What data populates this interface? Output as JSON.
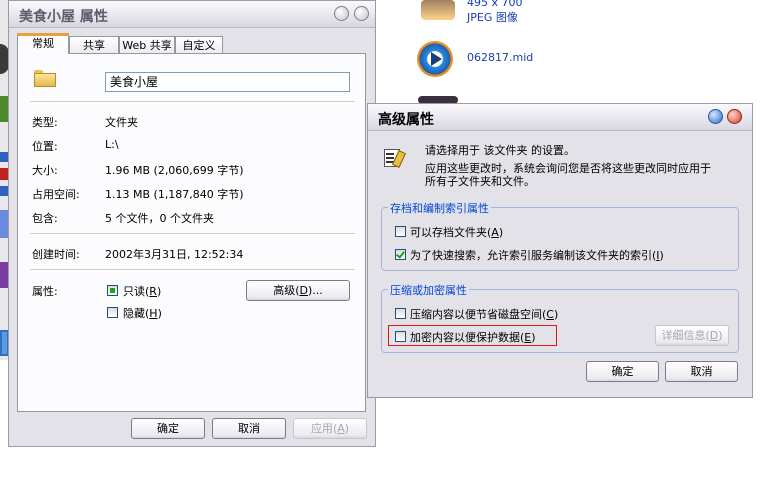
{
  "explorer": {
    "items": [
      {
        "caption": "495 x 700",
        "type_label": "JPEG 图像"
      },
      {
        "name": "062817.mid"
      }
    ]
  },
  "props": {
    "title": "美食小屋 属性",
    "tabs": [
      "常规",
      "共享",
      "Web 共享",
      "自定义"
    ],
    "folder_name": "美食小屋",
    "rows": [
      {
        "label": "类型:",
        "value": "文件夹"
      },
      {
        "label": "位置:",
        "value": "L:\\"
      },
      {
        "label": "大小:",
        "value": "1.96 MB (2,060,699 字节)"
      },
      {
        "label": "占用空间:",
        "value": "1.13 MB (1,187,840 字节)"
      },
      {
        "label": "包含:",
        "value": "5 个文件，0 个文件夹"
      },
      {
        "label": "创建时间:",
        "value": "2002年3月31日, 12:52:34"
      }
    ],
    "attributes_label": "属性:",
    "readonly": {
      "label": "只读",
      "key": "R"
    },
    "hidden": {
      "label": "隐藏",
      "key": "H"
    },
    "advanced_button": {
      "label": "高级",
      "key": "D",
      "suffix": "..."
    },
    "ok": "确定",
    "cancel": "取消",
    "apply": {
      "label": "应用",
      "key": "A"
    }
  },
  "advanced": {
    "title": "高级属性",
    "desc1": "请选择用于 该文件夹 的设置。",
    "desc2": "应用这些更改时，系统会询问您是否将这些更改同时应用于",
    "desc3": "所有子文件夹和文件。",
    "group1": {
      "title": "存档和编制索引属性",
      "archive": {
        "label": "可以存档文件夹",
        "key": "A",
        "checked": false
      },
      "index": {
        "label": "为了快速搜索，允许索引服务编制该文件夹的索引",
        "key": "I",
        "checked": true
      }
    },
    "group2": {
      "title": "压缩或加密属性",
      "compress": {
        "label": "压缩内容以便节省磁盘空间",
        "key": "C",
        "checked": false
      },
      "encrypt": {
        "label": "加密内容以便保护数据",
        "key": "E",
        "checked": false
      },
      "details": {
        "label": "详细信息",
        "key": "D"
      }
    },
    "ok": "确定",
    "cancel": "取消",
    "highlight_color": "#e0161b"
  }
}
